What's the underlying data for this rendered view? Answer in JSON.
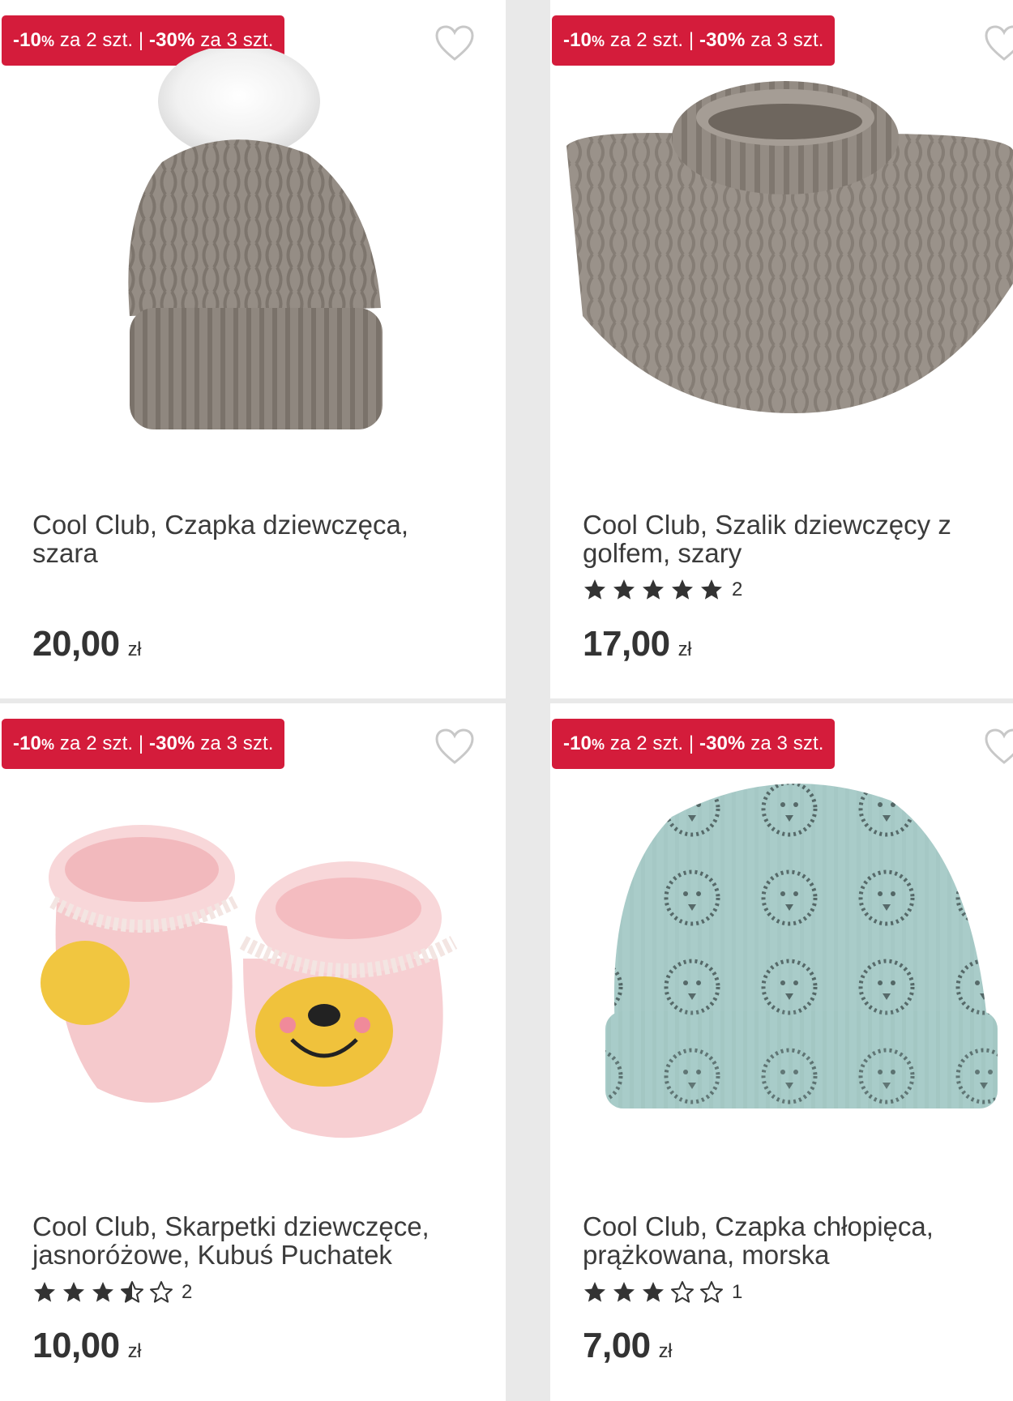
{
  "products": [
    {
      "promo": {
        "p1": "-10",
        "pct1": "%",
        "t1": " za 2 szt. | ",
        "p2": "-30",
        "pct2": "%",
        "t2": " za 3 szt."
      },
      "name": "Cool Club, Czapka dziewczęca, szara",
      "rating": null,
      "review_count": "",
      "price": "20,00",
      "currency": "zł",
      "image_icon": "grey-knit-pompom-beanie"
    },
    {
      "promo": {
        "p1": "-10",
        "pct1": "%",
        "t1": " za 2 szt. | ",
        "p2": "-30",
        "pct2": "%",
        "t2": " za 3 szt."
      },
      "name": "Cool Club, Szalik dziewczęcy z golfem, szary",
      "rating": 5,
      "review_count": "2",
      "price": "17,00",
      "currency": "zł",
      "image_icon": "grey-knit-turtleneck-scarf"
    },
    {
      "promo": {
        "p1": "-10",
        "pct1": "%",
        "t1": " za 2 szt. | ",
        "p2": "-30",
        "pct2": "%",
        "t2": " za 3 szt."
      },
      "name": "Cool Club, Skarpetki dziewczęce, jasnoróżowe, Kubuś Puchatek",
      "rating": 3.5,
      "review_count": "2",
      "price": "10,00",
      "currency": "zł",
      "image_icon": "pink-baby-socks-winnie"
    },
    {
      "promo": {
        "p1": "-10",
        "pct1": "%",
        "t1": " za 2 szt. | ",
        "p2": "-30",
        "pct2": "%",
        "t2": " za 3 szt."
      },
      "name": "Cool Club, Czapka chłopięca, prążkowana, morska",
      "rating": 3,
      "review_count": "1",
      "price": "7,00",
      "currency": "zł",
      "image_icon": "mint-ribbed-hedgehog-beanie"
    }
  ],
  "colors": {
    "promo_bg": "#d41c3b",
    "star": "#333333",
    "heart": "#c8c8c8"
  }
}
